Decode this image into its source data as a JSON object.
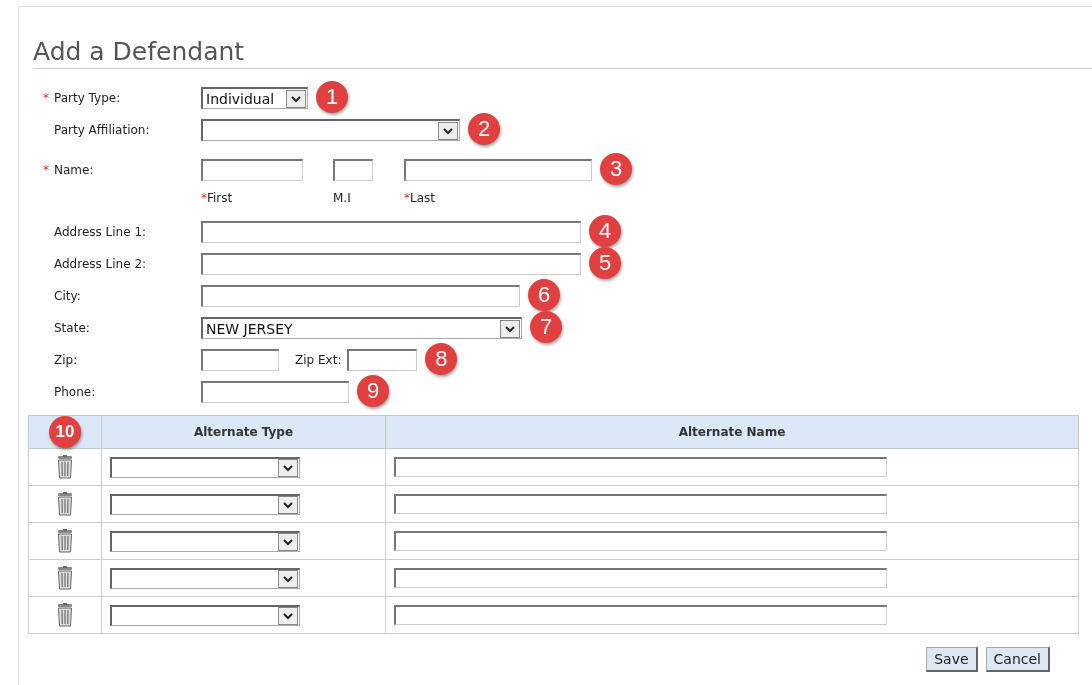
{
  "title": "Add a Defendant",
  "fields": [
    {
      "kind": "select",
      "mark": "*",
      "label": "Party Type:",
      "value": "Individual",
      "callout": "1"
    },
    {
      "kind": "select",
      "label": "Party Affiliation:",
      "callout": "2"
    },
    {
      "kind": "name",
      "mark": "*",
      "label": "Name:",
      "callout": "3",
      "parts": [
        {
          "mark": "*",
          "caption": "First"
        },
        {
          "caption": "M.I"
        },
        {
          "mark": "*",
          "caption": "Last"
        }
      ]
    },
    {
      "kind": "text",
      "label": "Address Line 1:",
      "callout": "4"
    },
    {
      "kind": "text",
      "label": "Address Line 2:",
      "callout": "5"
    },
    {
      "kind": "text",
      "label": "City:",
      "callout": "6"
    },
    {
      "kind": "select",
      "label": "State:",
      "value": "NEW JERSEY",
      "callout": "7"
    },
    {
      "kind": "zip",
      "label": "Zip:",
      "ext_label": "Zip Ext:",
      "callout": "8"
    },
    {
      "kind": "text",
      "label": "Phone:",
      "callout": "9"
    }
  ],
  "alternates": {
    "callout": "10",
    "columns": [
      "Alternate Type",
      "Alternate Name"
    ],
    "rows": [
      {
        "kind": "entry"
      },
      {
        "kind": "entry"
      },
      {
        "kind": "entry"
      },
      {
        "kind": "entry"
      },
      {
        "kind": "entry"
      }
    ]
  },
  "buttons": [
    "Save",
    "Cancel"
  ]
}
